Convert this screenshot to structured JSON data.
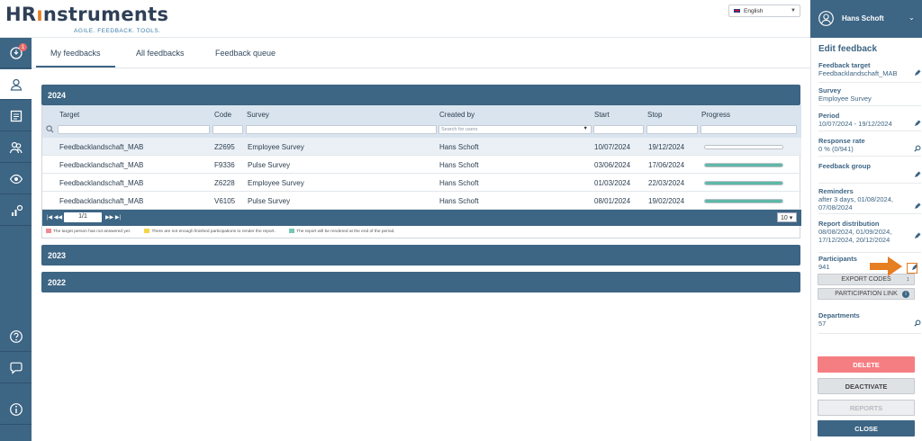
{
  "brand": {
    "logo_text_1": "HR",
    "logo_text_2": "nstruments",
    "tagline": "AGILE. FEEDBACK. TOOLS."
  },
  "language": {
    "selected": "English"
  },
  "sidebar": {
    "notification_count": "1"
  },
  "tabs": [
    {
      "label": "My feedbacks",
      "active": true
    },
    {
      "label": "All feedbacks",
      "active": false
    },
    {
      "label": "Feedback queue",
      "active": false
    }
  ],
  "years": [
    "2024",
    "2023",
    "2022"
  ],
  "table": {
    "columns": {
      "target": "Target",
      "code": "Code",
      "survey": "Survey",
      "created_by": "Created by",
      "start": "Start",
      "stop": "Stop",
      "progress": "Progress"
    },
    "created_by_placeholder": "Search for users",
    "rows": [
      {
        "target": "Feedbacklandschaft_MAB",
        "code": "Z2695",
        "survey": "Employee Survey",
        "created_by": "Hans Schoft",
        "start": "10/07/2024",
        "stop": "19/12/2024",
        "progress": 0
      },
      {
        "target": "Feedbacklandschaft_MAB",
        "code": "F9336",
        "survey": "Pulse Survey",
        "created_by": "Hans Schoft",
        "start": "03/06/2024",
        "stop": "17/06/2024",
        "progress": 100
      },
      {
        "target": "Feedbacklandschaft_MAB",
        "code": "Z6228",
        "survey": "Employee Survey",
        "created_by": "Hans Schoft",
        "start": "01/03/2024",
        "stop": "22/03/2024",
        "progress": 100
      },
      {
        "target": "Feedbacklandschaft_MAB",
        "code": "V6105",
        "survey": "Pulse Survey",
        "created_by": "Hans Schoft",
        "start": "08/01/2024",
        "stop": "19/02/2024",
        "progress": 100
      }
    ],
    "pager": {
      "page": "1/1",
      "page_size": "10"
    },
    "legend": [
      {
        "color": "#f28a93",
        "text": "The target person has not answered yet."
      },
      {
        "color": "#f5d44a",
        "text": "There are not enough finished participations to render the report."
      },
      {
        "color": "#76c7b7",
        "text": "The report will be rendered at the end of the period."
      }
    ]
  },
  "user": {
    "name": "Hans Schoft"
  },
  "edit_panel": {
    "title": "Edit feedback",
    "fields": [
      {
        "label": "Feedback target",
        "value": "Feedbacklandschaft_MAB",
        "icon": "pencil"
      },
      {
        "label": "Survey",
        "value": "Employee Survey",
        "icon": "none"
      },
      {
        "label": "Period",
        "value": "10/07/2024 - 19/12/2024",
        "icon": "pencil"
      },
      {
        "label": "Response rate",
        "value": "0 % (0/941)",
        "icon": "magnifier"
      },
      {
        "label": "Feedback group",
        "value": "",
        "icon": "pencil"
      },
      {
        "label": "Reminders",
        "value": "after 3 days, 01/08/2024, 07/08/2024",
        "icon": "pencil"
      },
      {
        "label": "Report distribution",
        "value": "08/08/2024, 01/09/2024, 17/12/2024, 20/12/2024",
        "icon": "pencil"
      },
      {
        "label": "Participants",
        "value": "941",
        "icon": "pencil"
      },
      {
        "label": "Departments",
        "value": "57",
        "icon": "magnifier"
      }
    ],
    "export_codes": "EXPORT CODES",
    "participation_link": "PARTICIPATION LINK",
    "delete": "DELETE",
    "deactivate": "DEACTIVATE",
    "reports": "REPORTS",
    "close": "CLOSE"
  },
  "colors": {
    "primary": "#3d6584",
    "accent": "#e67e22",
    "progress": "#5fb8a8",
    "delete": "#f57e82"
  }
}
